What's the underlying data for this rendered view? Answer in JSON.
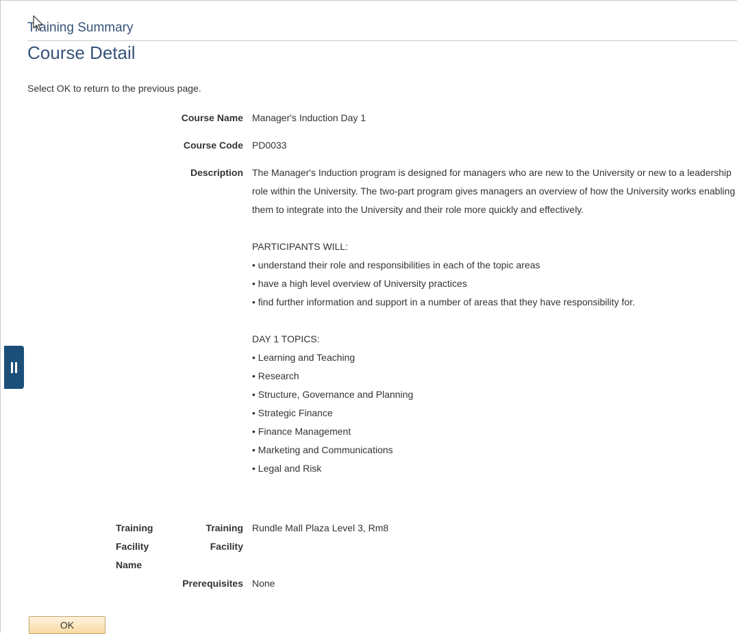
{
  "header": {
    "breadcrumb": "Training Summary",
    "page_title": "Course Detail"
  },
  "instructions": "Select OK to return to the previous page.",
  "fields": {
    "course_name": {
      "label": "Course Name",
      "value": "Manager's Induction Day 1"
    },
    "course_code": {
      "label": "Course Code",
      "value": "PD0033"
    },
    "description": {
      "label": "Description",
      "intro": "The Manager's Induction program is designed for managers who are new to the University or new to a leadership role within the University. The two-part program gives managers an overview of how the University works enabling them to integrate into the University and their role more quickly and effectively.",
      "participants_heading": "PARTICIPANTS WILL:",
      "participants": [
        "• understand their role and responsibilities in each of the topic areas",
        "• have a high level overview of University practices",
        "• find further information and support in a number of areas that they have responsibility for."
      ],
      "topics_heading": "DAY 1 TOPICS:",
      "topics": [
        "• Learning and Teaching",
        "• Research",
        "• Structure, Governance and Planning",
        "• Strategic Finance",
        "• Finance Management",
        "• Marketing and Communications",
        "• Legal and Risk"
      ]
    },
    "training_facility": {
      "label_left_line1": "Training",
      "label_left_line2": "Facility",
      "label_left_line3": "Name",
      "label_right_line1": "Training",
      "label_right_line2": "Facility",
      "value": "Rundle Mall Plaza Level 3, Rm8"
    },
    "prerequisites": {
      "label": "Prerequisites",
      "value": "None"
    }
  },
  "buttons": {
    "ok_label": "OK"
  },
  "colors": {
    "title": "#36537a",
    "side_tab": "#1b4f7a",
    "ok_button": "#f8d9a4"
  },
  "icons": {
    "side_tab": "pause-icon",
    "cursor": "mouse-pointer-icon"
  }
}
